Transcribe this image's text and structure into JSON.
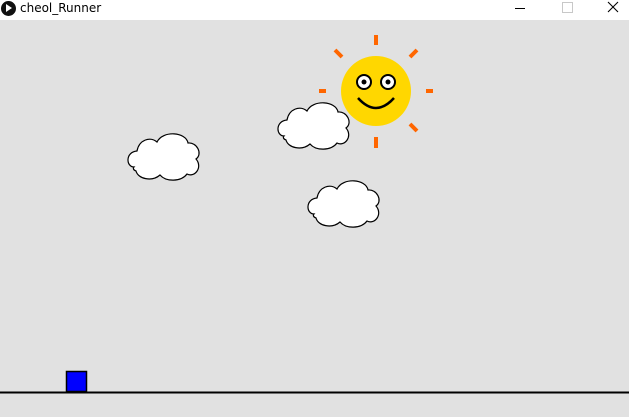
{
  "window": {
    "title": "cheol_Runner"
  },
  "controls": {
    "minimize_icon": "minimize-icon",
    "maximize_icon": "maximize-icon",
    "close_icon": "close-icon"
  },
  "game": {
    "background_color": "#e1e1e1",
    "sun": {
      "color": "#ffd700",
      "ray_color": "#ff6600",
      "face": "smiling"
    },
    "clouds": {
      "count": 3,
      "fill": "#ffffff",
      "outline": "#000000"
    },
    "player": {
      "shape": "square",
      "color": "#0000ff"
    },
    "ground": {
      "color": "#000000"
    }
  }
}
